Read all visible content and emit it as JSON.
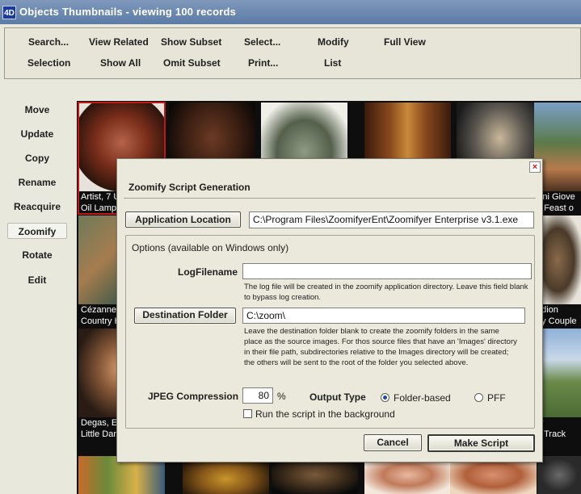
{
  "window": {
    "title": "Objects Thumbnails - viewing 100 records",
    "app_icon_text": "4D"
  },
  "toolbar": {
    "search": "Search...",
    "view_related": "View Related",
    "show_subset": "Show Subset",
    "select": "Select...",
    "modify": "Modify",
    "full_view": "Full View",
    "selection": "Selection",
    "show_all": "Show All",
    "omit_subset": "Omit Subset",
    "print": "Print...",
    "list": "List"
  },
  "sidebar": {
    "move": "Move",
    "update": "Update",
    "copy": "Copy",
    "rename": "Rename",
    "reacquire": "Reacquire",
    "zoomify": "Zoomify",
    "rotate": "Rotate",
    "edit": "Edit"
  },
  "thumbnails": {
    "r1c1": {
      "cap1": "Artist, 7 U",
      "cap2": "Oil Lamp"
    },
    "r1c6": {
      "cap1": "llini Giove",
      "cap2": "e Feast o"
    },
    "r2c1": {
      "cap1": "Cézanne",
      "cap2": "Country H"
    },
    "r2c6": {
      "cap1": "odion",
      "cap2": "iry Couple"
    },
    "r3c1": {
      "cap1": "Degas, E",
      "cap2": "Little Dan"
    },
    "r3c6": {
      "cap1": "fy",
      "cap2": "e Track"
    }
  },
  "dialog": {
    "title": "Zoomify Script Generation",
    "close_glyph": "×",
    "app_location_button": "Application Location",
    "app_location_value": "C:\\Program Files\\ZoomifyerEnt\\Zoomifyer Enterprise v3.1.exe",
    "options_heading": "Options (available on Windows only)",
    "log_label": "LogFilename",
    "log_value": "",
    "log_note": "The log file will be created in the zoomify application directory. Leave this field blank to bypass log creation.",
    "dest_button": "Destination Folder",
    "dest_value": "C:\\zoom\\",
    "dest_note": "Leave the destination folder blank to create the zoomify folders in the same place as the source images. For thos source files that have an 'Images' directory in their file path, subdirectories relative to the Images directory will be created; the others will be sent to the root of the folder you selected above.",
    "jpeg_label": "JPEG Compression",
    "jpeg_value": "80",
    "percent": "%",
    "output_type_label": "Output Type",
    "folder_based": "Folder-based",
    "pff": "PFF",
    "output_selected": "Folder-based",
    "background_checkbox": "Run the script in the background",
    "background_checked": false,
    "cancel": "Cancel",
    "make_script": "Make Script"
  }
}
